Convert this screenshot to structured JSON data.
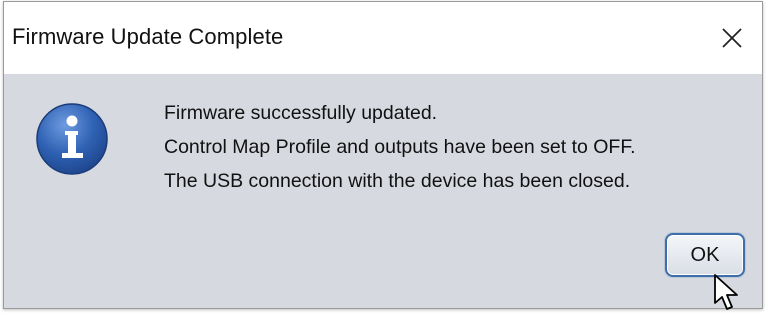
{
  "window": {
    "title": "Firmware Update Complete"
  },
  "dialog": {
    "icon": "information-icon",
    "message_lines": [
      "Firmware successfully updated.",
      "Control Map Profile and outputs have been set to OFF.",
      "The USB connection with the device has been closed."
    ],
    "ok_label": "OK"
  },
  "colors": {
    "title_bar": "#ffffff",
    "content_bg": "#d6d9df",
    "icon_blue": "#2f62b4",
    "button_border": "#3f6ea8"
  }
}
